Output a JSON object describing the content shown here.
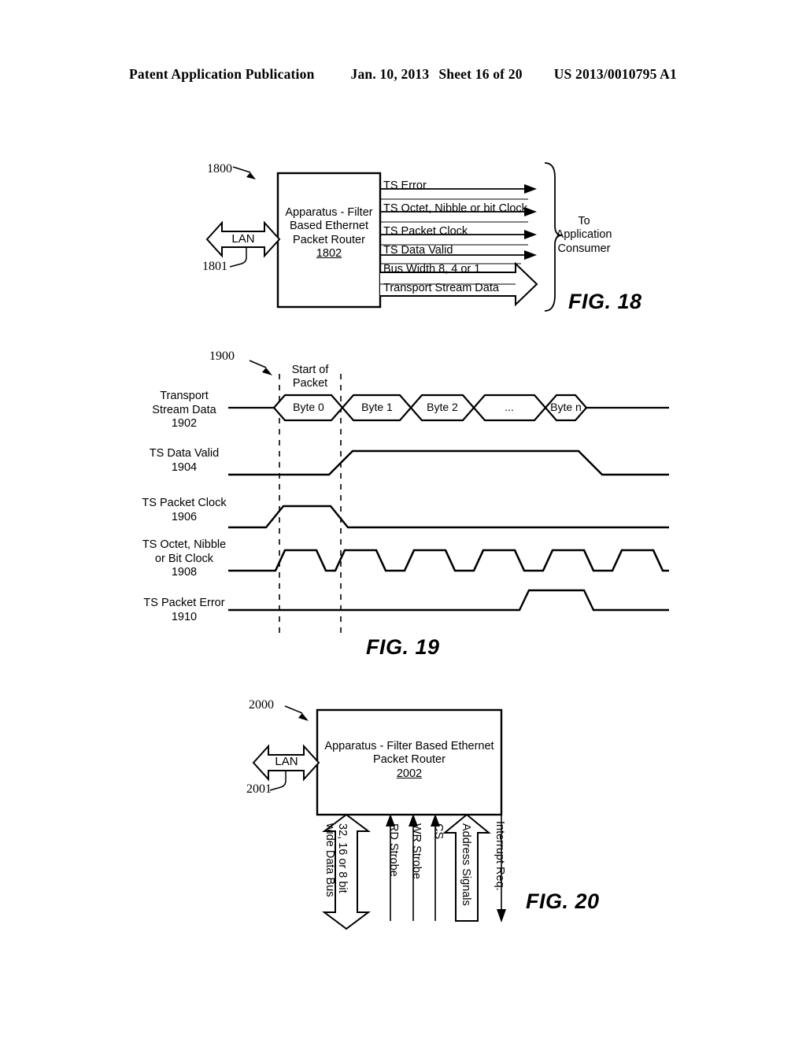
{
  "header": {
    "publication": "Patent Application Publication",
    "date": "Jan. 10, 2013",
    "sheet": "Sheet 16 of 20",
    "docnumber": "US 2013/0010795 A1"
  },
  "figures": [
    {
      "id": "fig18",
      "caption": "FIG. 18",
      "ref_numerals": {
        "system": "1800",
        "lan_port": "1801",
        "apparatus": "1802"
      },
      "apparatus_box": {
        "line1": "Apparatus - Filter",
        "line2": "Based Ethernet",
        "line3": "Packet Router",
        "ref": "1802"
      },
      "lan": {
        "label": "LAN",
        "ref": "1801",
        "type": "bidirectional"
      },
      "output_signals": [
        {
          "label": "TS Error",
          "arrow": "thin"
        },
        {
          "label": "TS Octet, Nibble or bit Clock",
          "arrow": "thin"
        },
        {
          "label": "TS Packet Clock",
          "arrow": "thin"
        },
        {
          "label": "TS Data Valid",
          "arrow": "thin"
        },
        {
          "label": "Bus Width 8, 4 or 1",
          "arrow": "none"
        },
        {
          "label": "Transport Stream Data",
          "arrow": "bus"
        }
      ],
      "destination": {
        "line1": "To",
        "line2": "Application",
        "line3": "Consumer"
      }
    },
    {
      "id": "fig19",
      "caption": "FIG. 19",
      "ref_numerals": {
        "timing_diagram": "1900"
      },
      "marker": {
        "line1": "Start of",
        "line2": "Packet"
      },
      "waveforms": [
        {
          "name_line1": "Transport",
          "name_line2": "Stream Data",
          "ref": "1902",
          "type": "bus",
          "cells": [
            "Byte 0",
            "Byte 1",
            "Byte 2",
            "...",
            "Byte n"
          ]
        },
        {
          "name_line1": "TS Data Valid",
          "name_line2": "",
          "ref": "1904",
          "type": "level",
          "description": "low, rises after start of packet, high through packet, falls near end"
        },
        {
          "name_line1": "TS Packet Clock",
          "name_line2": "",
          "ref": "1906",
          "type": "pulse",
          "description": "single wide pulse aligned with start of packet"
        },
        {
          "name_line1": "TS Octet, Nibble",
          "name_line2": "or Bit  Clock",
          "ref": "1908",
          "type": "clock",
          "cycles": 7,
          "description": "repeating trapezoidal clock"
        },
        {
          "name_line1": "TS Packet Error",
          "name_line2": "",
          "ref": "1910",
          "type": "pulse",
          "description": "low, single pulse late in the packet"
        }
      ]
    },
    {
      "id": "fig20",
      "caption": "FIG. 20",
      "ref_numerals": {
        "system": "2000",
        "lan_port": "2001",
        "apparatus": "2002"
      },
      "apparatus_box": {
        "line1": "Apparatus - Filter Based Ethernet",
        "line2": "Packet Router",
        "ref": "2002"
      },
      "lan": {
        "label": "LAN",
        "ref": "2001",
        "type": "bidirectional"
      },
      "bottom_signals": [
        {
          "label_line1": "32, 16 or 8 bit",
          "label_line2": "wide Data Bus",
          "type": "bus-bidirectional"
        },
        {
          "label_line1": "RD Strobe",
          "label_line2": "",
          "type": "in"
        },
        {
          "label_line1": "WR Strobe",
          "label_line2": "",
          "type": "in"
        },
        {
          "label_line1": "CS",
          "label_line2": "",
          "type": "in"
        },
        {
          "label_line1": "Address Signals",
          "label_line2": "",
          "type": "bus-in"
        },
        {
          "label_line1": "Interrupt Req.",
          "label_line2": "",
          "type": "out"
        }
      ]
    }
  ],
  "colors": {
    "ink": "#000000",
    "paper": "#ffffff"
  }
}
